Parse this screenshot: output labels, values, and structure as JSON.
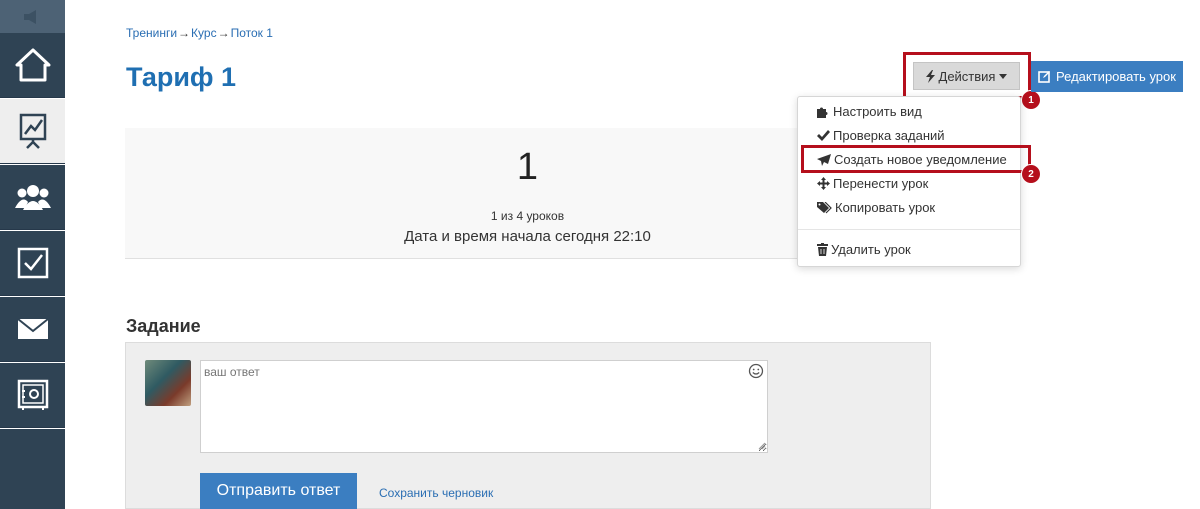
{
  "sidebar": {
    "items": [
      {
        "icon": "home-icon"
      },
      {
        "icon": "chart-board-icon",
        "active": true
      },
      {
        "icon": "users-icon"
      },
      {
        "icon": "checkbox-icon"
      },
      {
        "icon": "envelope-icon"
      },
      {
        "icon": "safe-icon"
      }
    ]
  },
  "breadcrumb": {
    "items": [
      "Тренинги",
      "Курс",
      "Поток 1"
    ],
    "separator": "→"
  },
  "page_title": "Тариф 1",
  "actions_button": {
    "label": "Действия",
    "badge": "1"
  },
  "edit_button": {
    "label": "Редактировать урок"
  },
  "dropdown": {
    "items": [
      {
        "label": "Настроить вид",
        "icon": "puzzle-icon"
      },
      {
        "label": "Проверка заданий",
        "icon": "check-icon"
      },
      {
        "label": "Создать новое уведомление",
        "icon": "paper-plane-icon",
        "badge": "2"
      },
      {
        "label": "Перенести урок",
        "icon": "move-icon"
      },
      {
        "label": "Копировать урок",
        "icon": "tags-icon"
      },
      {
        "label": "Удалить урок",
        "icon": "trash-icon"
      }
    ]
  },
  "lesson": {
    "number": "1",
    "count": "1 из 4 уроков",
    "date": "Дата и время начала сегодня 22:10"
  },
  "task": {
    "title": "Задание",
    "answer_placeholder": "ваш ответ",
    "send_label": "Отправить ответ",
    "draft_label": "Сохранить черновик"
  },
  "colors": {
    "accent": "#3b7ec1",
    "title": "#1f6fb2",
    "sidebar": "#2f4354",
    "highlight": "#b50f1c"
  }
}
